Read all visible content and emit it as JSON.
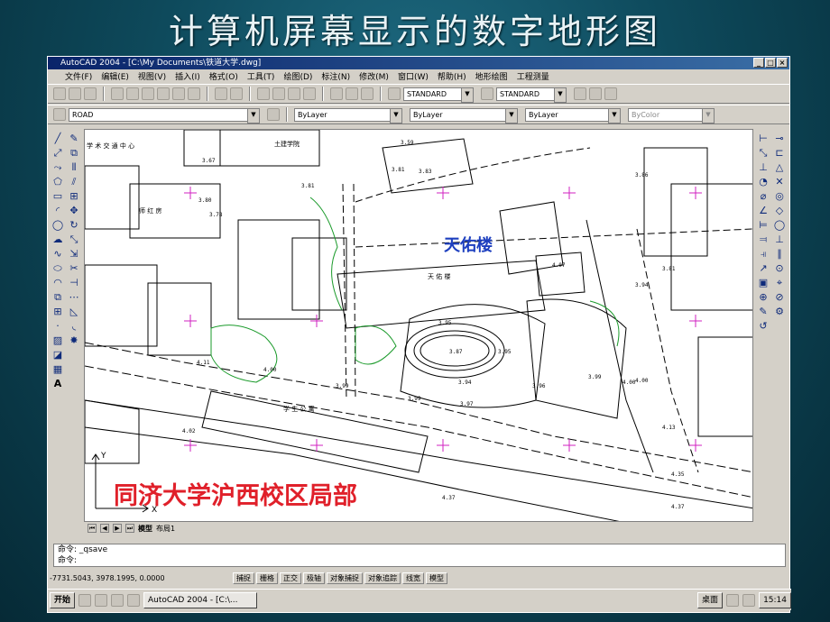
{
  "slide": {
    "title": "计算机屏幕显示的数字地形图"
  },
  "window": {
    "title": "AutoCAD 2004 - [C:\\My Documents\\铁道大学.dwg]"
  },
  "menu": [
    "文件(F)",
    "编辑(E)",
    "视图(V)",
    "插入(I)",
    "格式(O)",
    "工具(T)",
    "绘图(D)",
    "标注(N)",
    "修改(M)",
    "窗口(W)",
    "帮助(H)",
    "地形绘图",
    "工程测量"
  ],
  "toolbar": {
    "textstyle": "STANDARD",
    "dimstyle": "STANDARD",
    "layer": "ROAD",
    "color": "ByLayer",
    "linetype": "ByLayer",
    "lineweight": "ByLayer",
    "plotstyle": "ByColor"
  },
  "drawing": {
    "label_tianyou": "天佑楼",
    "label_campus": "同济大学沪西校区局部",
    "map_labels": {
      "tumu": "土建学院",
      "jiaotong": "学 术 交 通 中 心",
      "tianyou_small": "天 佑 楼",
      "xuesheng": "学 生 公 寓",
      "shijiang": "师 红 房"
    },
    "elevations": [
      "3.59",
      "3.67",
      "3.81",
      "3.83",
      "3.81",
      "3.86",
      "3.80",
      "3.78",
      "4.07",
      "3.81",
      "3.94",
      "3.95",
      "3.87",
      "3.95",
      "3.94",
      "3.96",
      "3.99",
      "4.00",
      "3.99",
      "3.97",
      "4.11",
      "4.00",
      "3.99",
      "4.00",
      "4.02",
      "4.13",
      "4.37",
      "4.37",
      "4.35"
    ]
  },
  "tabs": {
    "model": "模型",
    "layout1": "布局1"
  },
  "command": {
    "line1": "命令: _qsave",
    "line2": "命令:"
  },
  "status": {
    "coords": "-7731.5043, 3978.1995, 0.0000",
    "buttons": [
      "捕捉",
      "栅格",
      "正交",
      "极轴",
      "对象捕捉",
      "对象追踪",
      "线宽",
      "模型"
    ]
  },
  "taskbar": {
    "start": "开始",
    "task": "AutoCAD 2004 - [C:\\...",
    "tray": "桌面",
    "time": "15:14"
  }
}
